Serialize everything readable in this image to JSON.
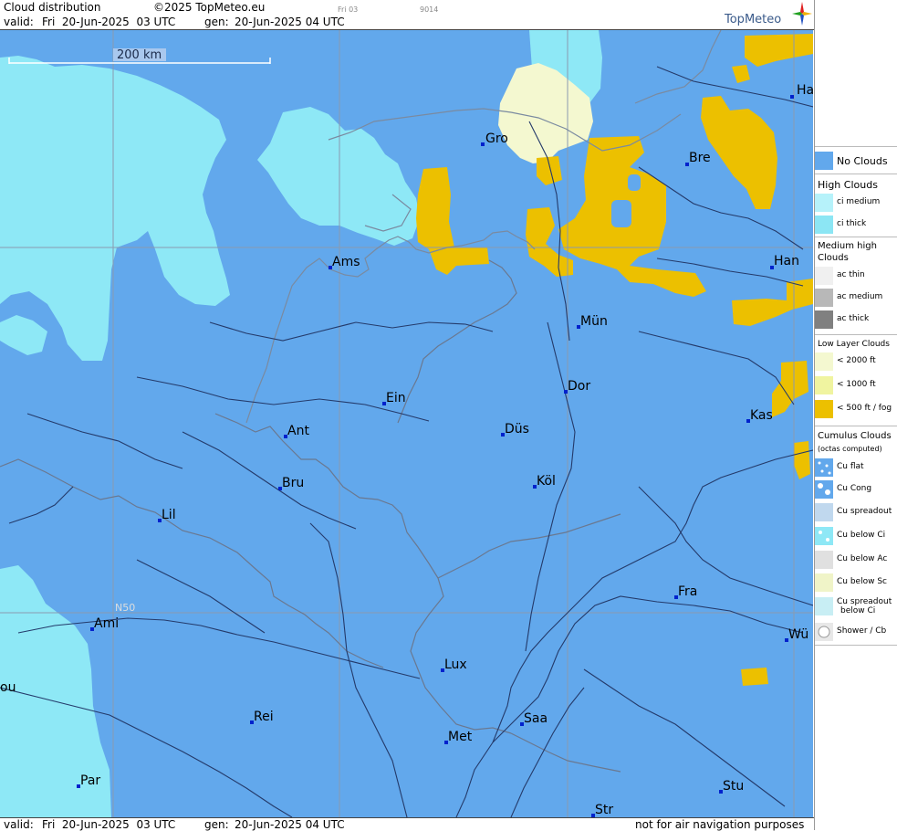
{
  "header": {
    "title": "Cloud distribution",
    "copyright": "©2025 TopMeteo.eu",
    "frame_small": "Fri 03",
    "code_small": "9014",
    "valid_label": "valid:",
    "valid_value": "Fri  20-Jun-2025  03 UTC",
    "gen_label": "gen:",
    "gen_value": "20-Jun-2025 04 UTC",
    "brand": "TopMeteo"
  },
  "footer": {
    "valid_label": "valid:",
    "valid_value": "Fri  20-Jun-2025  03 UTC",
    "gen_label": "gen:",
    "gen_value": "20-Jun-2025 04 UTC",
    "disclaimer": "not for air navigation purposes"
  },
  "map": {
    "scale_label": "200 km",
    "lat_label": "N50",
    "cities": [
      {
        "name": "Gro"
      },
      {
        "name": "Bre"
      },
      {
        "name": "Ha"
      },
      {
        "name": "Ams"
      },
      {
        "name": "Han"
      },
      {
        "name": "Mün"
      },
      {
        "name": "Ein"
      },
      {
        "name": "Dor"
      },
      {
        "name": "Kas"
      },
      {
        "name": "Ant"
      },
      {
        "name": "Düs"
      },
      {
        "name": "Bru"
      },
      {
        "name": "Köl"
      },
      {
        "name": "Lil"
      },
      {
        "name": "Fra"
      },
      {
        "name": "Ami"
      },
      {
        "name": "Wü"
      },
      {
        "name": "Lux"
      },
      {
        "name": "ou"
      },
      {
        "name": "Rei"
      },
      {
        "name": "Saa"
      },
      {
        "name": "Met"
      },
      {
        "name": "Par"
      },
      {
        "name": "Stu"
      },
      {
        "name": "Str"
      }
    ]
  },
  "legend": {
    "no_clouds": "No Clouds",
    "high_title": "High Clouds",
    "ci_medium": "ci medium",
    "ci_thick": "ci thick",
    "medium_title": "Medium high Clouds",
    "ac_thin": "ac thin",
    "ac_medium": "ac medium",
    "ac_thick": "ac thick",
    "low_title": "Low Layer Clouds",
    "low_2000": "< 2000 ft",
    "low_1000": "< 1000 ft",
    "low_500": "< 500 ft / fog",
    "cu_title": "Cumulus Clouds",
    "cu_sub": "(octas computed)",
    "cu_flat": "Cu flat",
    "cu_cong": "Cu Cong",
    "cu_spread": "Cu spreadout",
    "cu_below_ci": "Cu below Ci",
    "cu_below_ac": "Cu below Ac",
    "cu_below_sc": "Cu below Sc",
    "cu_spread_below_ci_1": "Cu spreadout",
    "cu_spread_below_ci_2": "below Ci",
    "shower": "Shower / Cb"
  },
  "colors": {
    "no_clouds": "#62a8ec",
    "ci_medium": "#9eeef8",
    "ci_thick": "#8ce6f4",
    "low_2000": "#f4f8d0",
    "low_1000": "#f0f4a0",
    "fog": "#ecc000"
  }
}
